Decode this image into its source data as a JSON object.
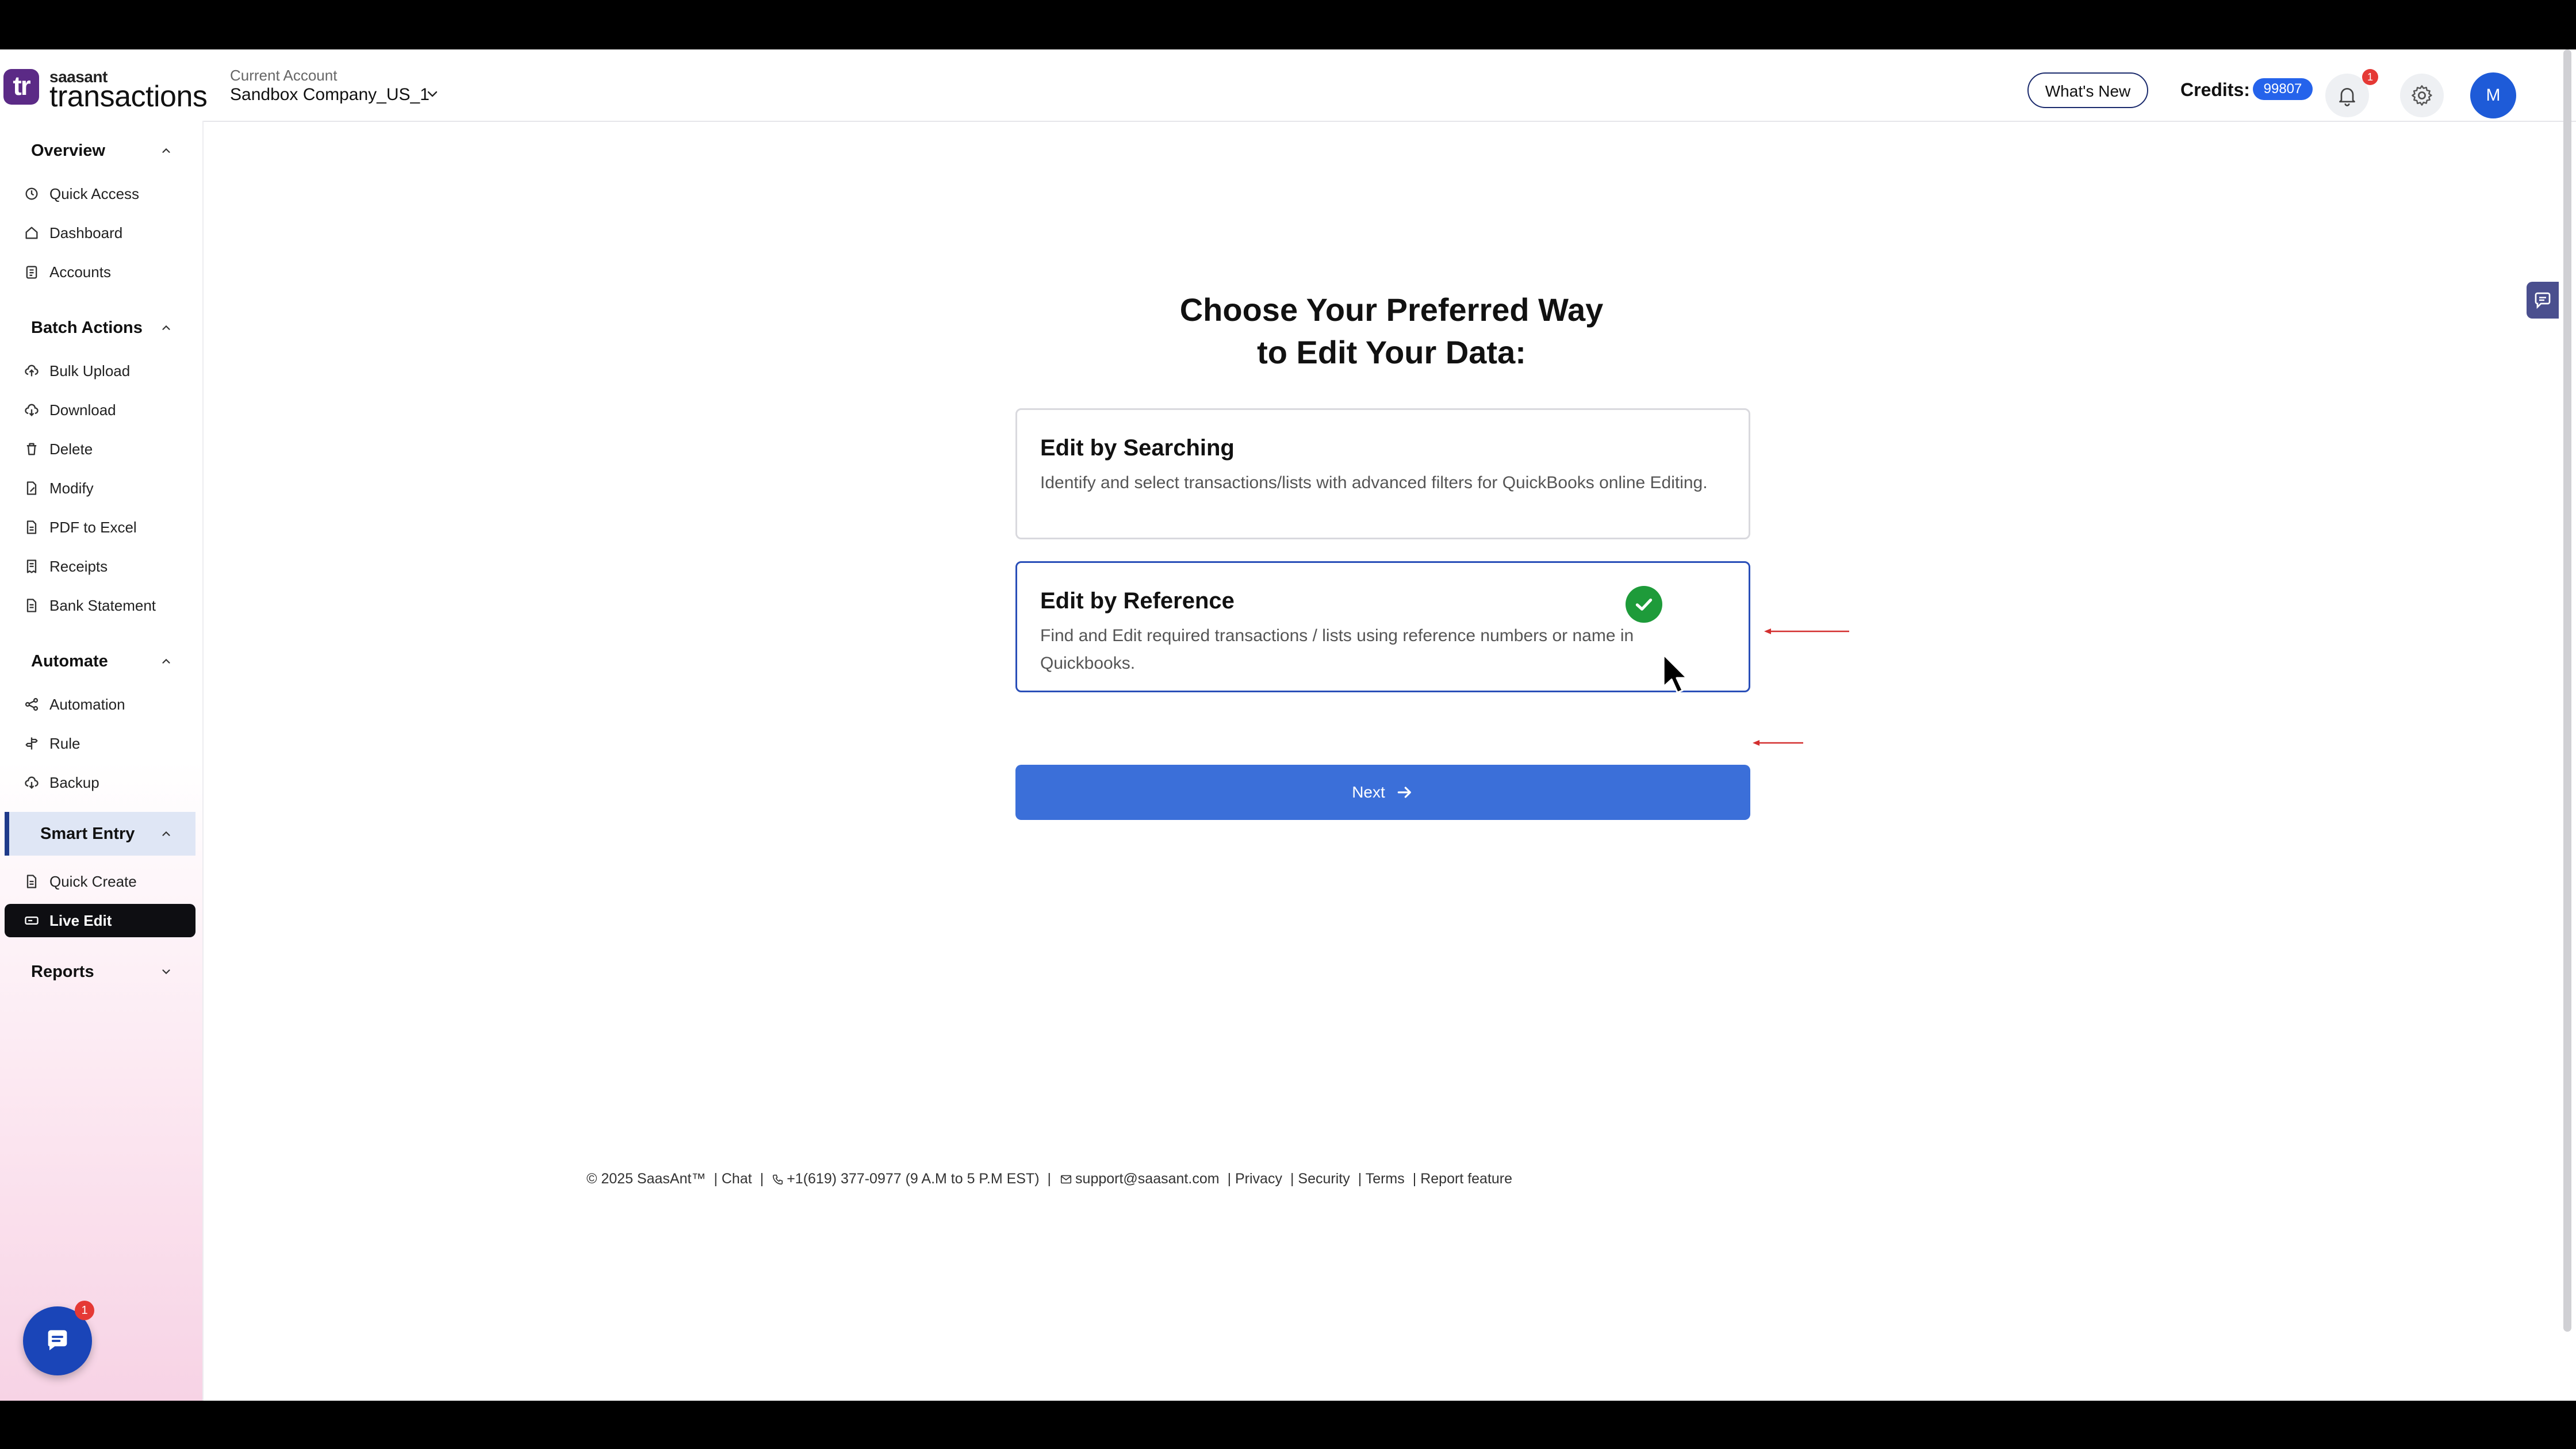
{
  "header": {
    "logo_small": "saasant",
    "logo_main": "transactions",
    "logo_mark": "tr",
    "account_label": "Current Account",
    "account_name": "Sandbox Company_US_1",
    "whats_new": "What's New",
    "credits_label": "Credits:",
    "credits_value": "99807",
    "notification_count": "1",
    "avatar_initial": "M"
  },
  "sidebar": {
    "overview": {
      "label": "Overview",
      "items": [
        "Quick Access",
        "Dashboard",
        "Accounts"
      ]
    },
    "batch_actions": {
      "label": "Batch Actions",
      "items": [
        "Bulk Upload",
        "Download",
        "Delete",
        "Modify",
        "PDF to Excel",
        "Receipts",
        "Bank Statement"
      ]
    },
    "automate": {
      "label": "Automate",
      "items": [
        "Automation",
        "Rule",
        "Backup"
      ]
    },
    "smart_entry": {
      "label": "Smart Entry",
      "items": [
        "Quick Create",
        "Live Edit"
      ]
    },
    "reports": {
      "label": "Reports"
    }
  },
  "main": {
    "title_line1": "Choose Your Preferred Way",
    "title_line2": "to Edit Your Data:",
    "options": [
      {
        "title": "Edit by Searching",
        "desc": "Identify and select transactions/lists with advanced filters for QuickBooks online Editing.",
        "selected": false
      },
      {
        "title": "Edit by Reference",
        "desc": "Find and Edit required transactions / lists using reference numbers or name in Quickbooks.",
        "selected": true
      }
    ],
    "next_label": "Next"
  },
  "footer": {
    "copyright": "© 2025 SaasAnt™",
    "chat": "| Chat",
    "phone": "+1(619) 377-0977 (9 A.M to 5 P.M EST)",
    "email": "support@saasant.com",
    "privacy": "| Privacy",
    "security": "| Security",
    "terms": "| Terms",
    "report": "| Report feature"
  },
  "chat_widget": {
    "badge": "1"
  },
  "colors": {
    "primary": "#3b6fd9",
    "brand": "#5b2a86",
    "success": "#1e9b3a",
    "annotation": "#d32f2f"
  }
}
